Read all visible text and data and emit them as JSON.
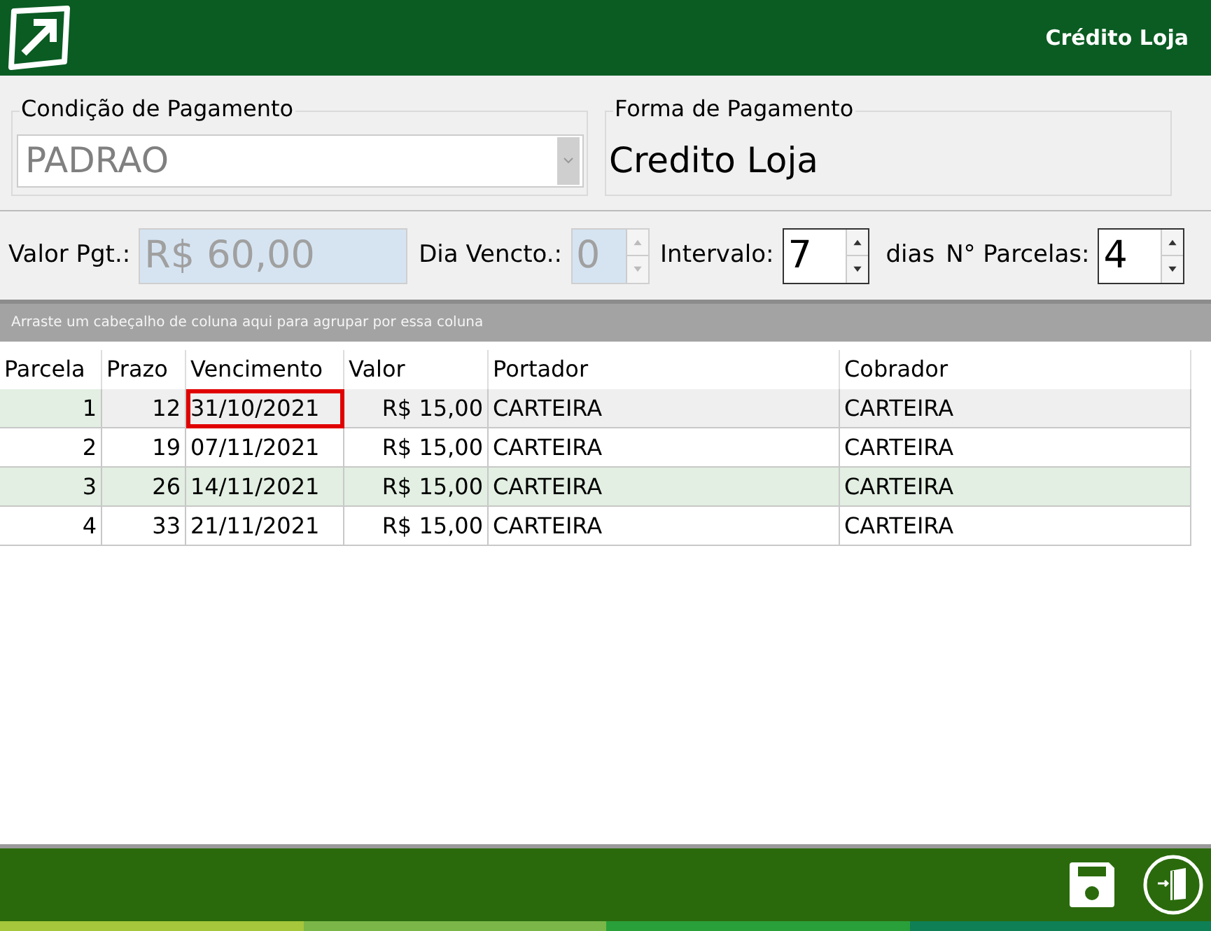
{
  "header": {
    "title": "Crédito Loja"
  },
  "condicao": {
    "label": "Condição de Pagamento",
    "value": "PADRAO",
    "disabled": true
  },
  "forma": {
    "label": "Forma de Pagamento",
    "value": "Credito Loja"
  },
  "fields": [
    {
      "kind": "text",
      "label": "Valor Pgt.:",
      "value": "R$ 60,00",
      "disabled": true
    },
    {
      "kind": "spin",
      "label": "Dia Vencto.:",
      "value": "0",
      "disabled": true
    },
    {
      "kind": "spin",
      "label": "Intervalo:",
      "value": "7",
      "disabled": false,
      "suffix": "dias"
    },
    {
      "kind": "spin",
      "label": "N° Parcelas:",
      "value": "4",
      "disabled": false
    }
  ],
  "group_panel": {
    "hint": "Arraste um cabeçalho de coluna aqui para agrupar por essa coluna"
  },
  "table": {
    "columns": [
      "Parcela",
      "Prazo",
      "Vencimento",
      "Valor",
      "Portador",
      "Cobrador"
    ],
    "rows": [
      {
        "cells": [
          "1",
          "12",
          "31/10/2021",
          "R$ 15,00",
          "CARTEIRA",
          "CARTEIRA"
        ],
        "selected": true,
        "focused": true
      },
      {
        "cells": [
          "2",
          "19",
          "07/11/2021",
          "R$ 15,00",
          "CARTEIRA",
          "CARTEIRA"
        ],
        "selected": false,
        "focused": false
      },
      {
        "cells": [
          "3",
          "26",
          "14/11/2021",
          "R$ 15,00",
          "CARTEIRA",
          "CARTEIRA"
        ],
        "selected": false,
        "focused": false
      },
      {
        "cells": [
          "4",
          "33",
          "21/11/2021",
          "R$ 15,00",
          "CARTEIRA",
          "CARTEIRA"
        ],
        "selected": false,
        "focused": false
      }
    ]
  }
}
